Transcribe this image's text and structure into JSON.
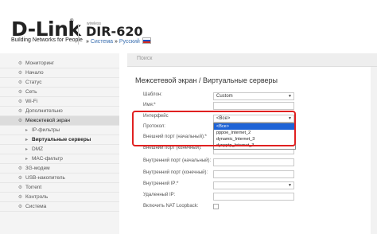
{
  "header": {
    "logo_text": "D-Link",
    "logo_tm": "®",
    "tagline": "Building Networks for People",
    "model_small": "wireless",
    "model": "DIR-620",
    "sysnav_prefix": "» ",
    "sysnav_system": "Система",
    "sysnav_sep": " » ",
    "sysnav_lang": "Русский"
  },
  "sidebar": {
    "items": [
      {
        "label": "Мониторинг"
      },
      {
        "label": "Начало"
      },
      {
        "label": "Статус"
      },
      {
        "label": "Сеть"
      },
      {
        "label": "Wi-Fi"
      },
      {
        "label": "Дополнительно"
      },
      {
        "label": "Межсетевой экран"
      },
      {
        "label": "IP-фильтры"
      },
      {
        "label": "Виртуальные серверы"
      },
      {
        "label": "DMZ"
      },
      {
        "label": "MAC-фильтр"
      },
      {
        "label": "3G-модем"
      },
      {
        "label": "USB-накопитель"
      },
      {
        "label": "Torrent"
      },
      {
        "label": "Контроль"
      },
      {
        "label": "Система"
      }
    ]
  },
  "search": {
    "label": "Поиск"
  },
  "page": {
    "title": "Межсетевой экран /  Виртуальные серверы"
  },
  "form": {
    "template_label": "Шаблон:",
    "template_value": "Custom",
    "name_label": "Имя:*",
    "interface_label": "Интерфейс",
    "interface_value": "<Все>",
    "protocol_label": "Протокол:",
    "ext_port_start_label": "Внешний порт (начальный):*",
    "ext_port_end_label": "Внешний порт (конечный):",
    "int_port_start_label": "Внутренний порт (начальный):",
    "int_port_end_label": "Внутренний порт (конечный):",
    "int_ip_label": "Внутренний IP:*",
    "remote_ip_label": "Удаленный IP:",
    "nat_loopback_label": "Включить NAT Loopback:"
  },
  "dropdown": {
    "options": [
      "<Все>",
      "pppoe_Internet_2",
      "dynamic_Internet_3",
      "dynpptp_Internet_3"
    ]
  },
  "colors": {
    "highlight": "#e02020",
    "selection": "#1e63d6"
  }
}
